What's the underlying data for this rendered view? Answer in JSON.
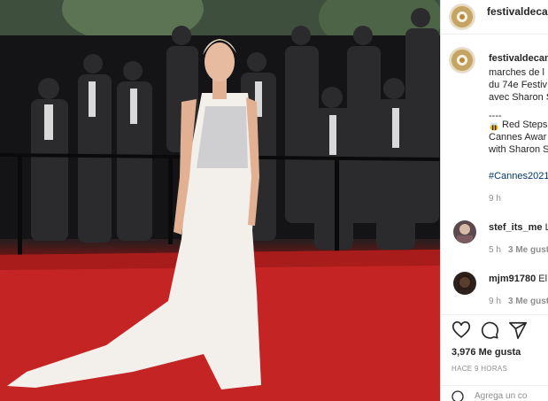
{
  "post": {
    "username": "festivaldecan",
    "caption_user": "festivaldecan",
    "caption_lines": [
      "marches de l",
      "du 74e Festiv",
      "avec Sharon S",
      "----",
      "Red Steps",
      "Cannes Awar",
      "with Sharon S"
    ],
    "hashtag": "#Cannes2021",
    "caption_time": "9 h"
  },
  "comments": [
    {
      "user": "stef_its_me",
      "text": "L",
      "time": "5 h",
      "likes": "3 Me gust"
    },
    {
      "user": "mjm91780",
      "text": "El",
      "time": "9 h",
      "likes": "3 Me gust"
    }
  ],
  "actions": {
    "like_icon": "heart-icon",
    "comment_icon": "comment-bubble-icon",
    "share_icon": "paper-plane-icon",
    "likes_count": "3,976 Me gusta",
    "time_ago": "HACE 9 HORAS",
    "add_comment_placeholder": "Agrega un co"
  },
  "colors": {
    "carpet": "#c42424",
    "link": "#00376b",
    "muted": "#8e8e8e"
  }
}
